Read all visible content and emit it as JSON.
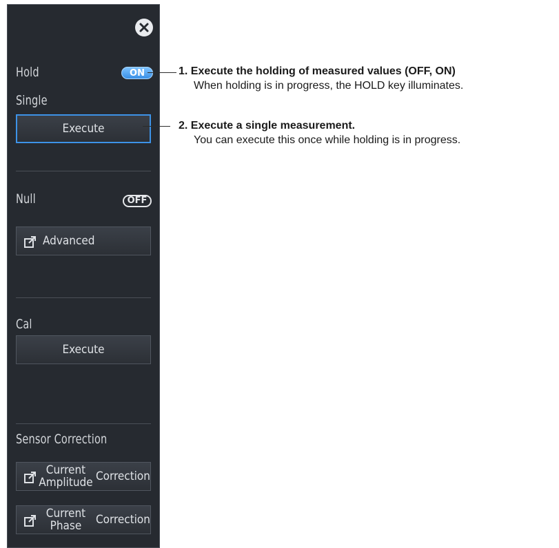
{
  "panel": {
    "close_icon": "close-icon",
    "hold": {
      "label": "Hold",
      "toggle": "ON"
    },
    "single": {
      "label": "Single",
      "button": "Execute"
    },
    "null": {
      "label": "Null",
      "toggle": "OFF",
      "advanced_button": "Advanced"
    },
    "cal": {
      "label": "Cal",
      "button": "Execute"
    },
    "sensor_correction": {
      "label": "Sensor Correction",
      "amplitude_button_line1": "Current Amplitude",
      "amplitude_button_line2": "Correction",
      "phase_button_line1": "Current Phase",
      "phase_button_line2": "Correction"
    }
  },
  "annotations": [
    {
      "number": "1.",
      "title": "Execute the holding of measured values (OFF, ON)",
      "text": "When holding is in progress, the HOLD key illuminates."
    },
    {
      "number": "2.",
      "title": "Execute a single measurement.",
      "text": "You can execute this once while holding is in progress."
    }
  ],
  "colors": {
    "panel_bg": "#262a30",
    "toggle_on": "#4aa3f5",
    "selected_border": "#3d93e8"
  }
}
